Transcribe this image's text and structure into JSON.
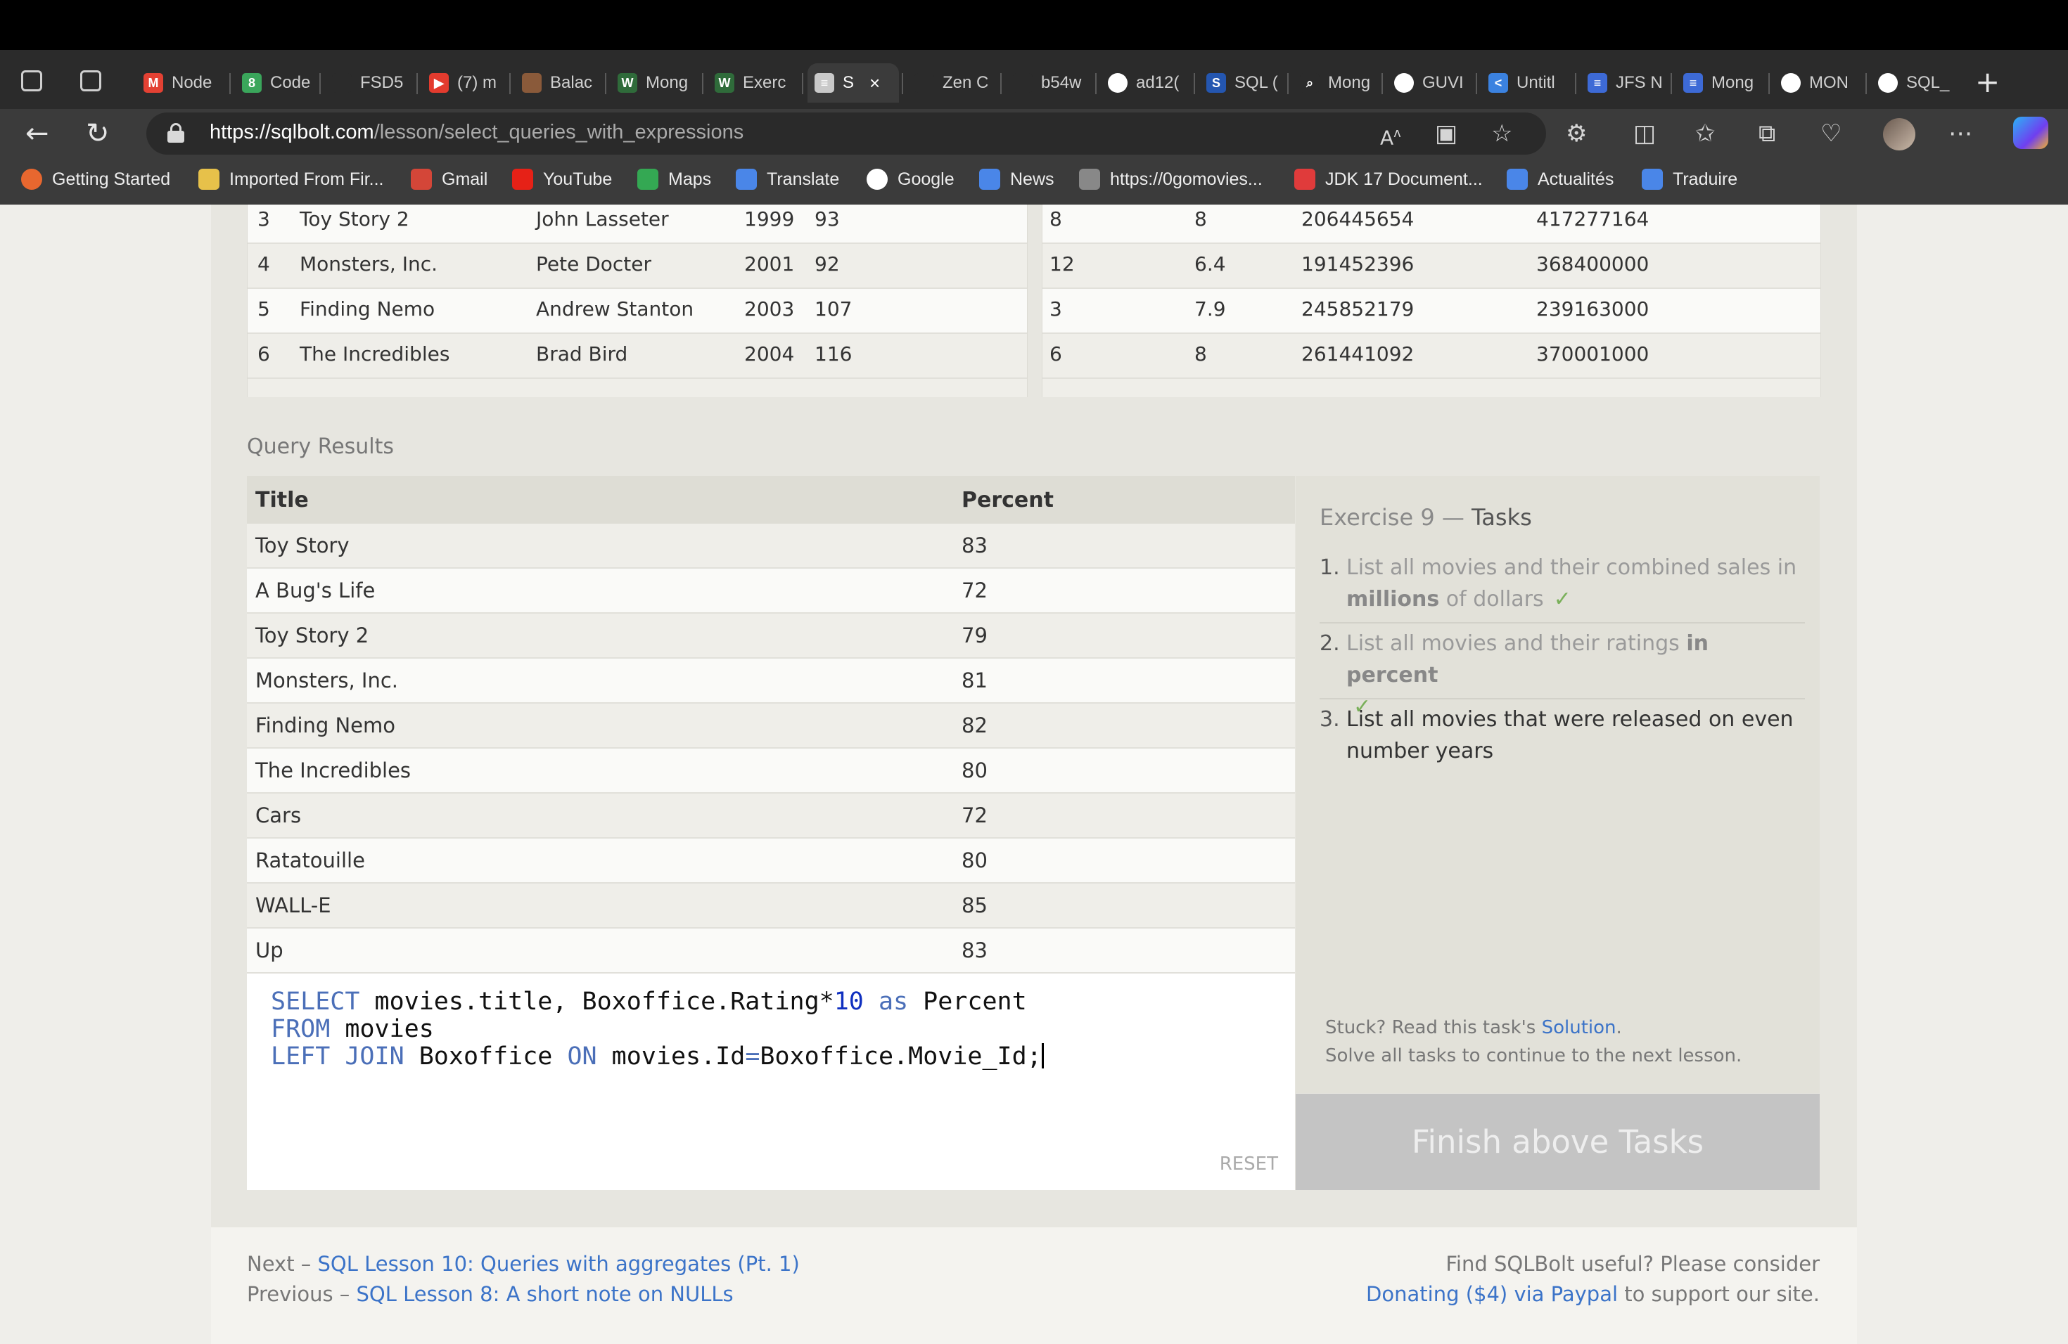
{
  "browser": {
    "tabs": [
      {
        "title": "Node",
        "fav_color": "#e34133",
        "fav_glyph": "M"
      },
      {
        "title": "Code",
        "fav_color": "#3aa65b",
        "fav_glyph": "8"
      },
      {
        "title": "FSD5",
        "fav_color": "#2b2b2b",
        "fav_glyph": ""
      },
      {
        "title": "(7) m",
        "fav_color": "#e33b2e",
        "fav_glyph": "▶"
      },
      {
        "title": "Balac",
        "fav_color": "#8a5a3a",
        "fav_glyph": ""
      },
      {
        "title": "Mong",
        "fav_color": "#2f6b3a",
        "fav_glyph": "W"
      },
      {
        "title": "Exerc",
        "fav_color": "#2f6b3a",
        "fav_glyph": "W"
      },
      {
        "title": "S",
        "fav_color": "#c9c9c9",
        "fav_glyph": "≡",
        "active": true
      },
      {
        "title": "Zen C",
        "fav_color": "#2b2b2b",
        "fav_glyph": ""
      },
      {
        "title": "b54w",
        "fav_color": "#2b2b2b",
        "fav_glyph": ""
      },
      {
        "title": "ad12(",
        "fav_color": "#ffffff",
        "fav_glyph": ""
      },
      {
        "title": "SQL (",
        "fav_color": "#2456b0",
        "fav_glyph": "S"
      },
      {
        "title": "Mong",
        "fav_color": "#2b2b2b",
        "fav_glyph": "⌕"
      },
      {
        "title": "GUVI",
        "fav_color": "#ffffff",
        "fav_glyph": ""
      },
      {
        "title": "Untitl",
        "fav_color": "#3b82e0",
        "fav_glyph": "<"
      },
      {
        "title": "JFS N",
        "fav_color": "#3d6ad6",
        "fav_glyph": "≡"
      },
      {
        "title": "Mong",
        "fav_color": "#3d6ad6",
        "fav_glyph": "≡"
      },
      {
        "title": "MON",
        "fav_color": "#ffffff",
        "fav_glyph": ""
      },
      {
        "title": "SQL_",
        "fav_color": "#ffffff",
        "fav_glyph": ""
      }
    ],
    "url_host": "https://sqlbolt.com",
    "url_path": "/lesson/select_queries_with_expressions",
    "bookmarks": [
      {
        "label": "Getting Started",
        "color": "#e8672f"
      },
      {
        "label": "Imported From Fir...",
        "color": "#e7c14a"
      },
      {
        "label": "Gmail",
        "color": "#d44638"
      },
      {
        "label": "YouTube",
        "color": "#e62117"
      },
      {
        "label": "Maps",
        "color": "#34a853"
      },
      {
        "label": "Translate",
        "color": "#4a86e8"
      },
      {
        "label": "Google",
        "color": "#ffffff"
      },
      {
        "label": "News",
        "color": "#4a86e8"
      },
      {
        "label": "https://0gomovies...",
        "color": "#888888"
      },
      {
        "label": "JDK 17 Document...",
        "color": "#e03b3b"
      },
      {
        "label": "Actualités",
        "color": "#4a86e8"
      },
      {
        "label": "Traduire",
        "color": "#4a86e8"
      }
    ]
  },
  "movies_table": {
    "rows": [
      [
        "3",
        "Toy Story 2",
        "John Lasseter",
        "1999",
        "93"
      ],
      [
        "4",
        "Monsters, Inc.",
        "Pete Docter",
        "2001",
        "92"
      ],
      [
        "5",
        "Finding Nemo",
        "Andrew Stanton",
        "2003",
        "107"
      ],
      [
        "6",
        "The Incredibles",
        "Brad Bird",
        "2004",
        "116"
      ]
    ]
  },
  "boxoffice_table": {
    "rows": [
      [
        "8",
        "8",
        "206445654",
        "417277164"
      ],
      [
        "12",
        "6.4",
        "191452396",
        "368400000"
      ],
      [
        "3",
        "7.9",
        "245852179",
        "239163000"
      ],
      [
        "6",
        "8",
        "261441092",
        "370001000"
      ]
    ]
  },
  "query_results": {
    "label": "Query Results",
    "columns": [
      "Title",
      "Percent"
    ],
    "rows": [
      [
        "Toy Story",
        "83"
      ],
      [
        "A Bug's Life",
        "72"
      ],
      [
        "Toy Story 2",
        "79"
      ],
      [
        "Monsters, Inc.",
        "81"
      ],
      [
        "Finding Nemo",
        "82"
      ],
      [
        "The Incredibles",
        "80"
      ],
      [
        "Cars",
        "72"
      ],
      [
        "Ratatouille",
        "80"
      ],
      [
        "WALL-E",
        "85"
      ],
      [
        "Up",
        "83"
      ]
    ]
  },
  "editor": {
    "line1_kw": "SELECT",
    "line1_a": " movies.title, Boxoffice.Rating*",
    "line1_num": "10",
    "line1_as": " as",
    "line1_b": " Percent",
    "line2_kw": "FROM",
    "line2_a": " movies",
    "line3_kw": "LEFT JOIN",
    "line3_a": " Boxoffice ",
    "line3_on": "ON",
    "line3_b": " movies.Id",
    "line3_eq": "=",
    "line3_c": "Boxoffice.Movie_Id;",
    "reset_label": "RESET"
  },
  "tasks": {
    "title_prefix": "Exercise 9 — ",
    "title_bold": "Tasks",
    "items": [
      {
        "num": "1.",
        "text_a": "List all movies and their combined sales in ",
        "bold": "millions",
        "text_b": " of dollars",
        "tick": "✓"
      },
      {
        "num": "2.",
        "text_a": "List all movies and their ratings ",
        "bold": "in percent",
        "text_b": "",
        "tick": "✓"
      },
      {
        "num": "3.",
        "text_a": "List all movies that were released on even number years",
        "bold": "",
        "text_b": "",
        "tick": ""
      }
    ],
    "stuck_prefix": "Stuck? Read this task's ",
    "solution_link": "Solution",
    "stuck_suffix": ".",
    "solve_all": "Solve all tasks to continue to the next lesson.",
    "finish_button": "Finish above Tasks"
  },
  "footer": {
    "next_prefix": "Next – ",
    "next_link": "SQL Lesson 10: Queries with aggregates (Pt. 1)",
    "prev_prefix": "Previous – ",
    "prev_link": "SQL Lesson 8: A short note on NULLs",
    "consider": "Find SQLBolt useful? Please consider",
    "donate_link": "Donating ($4) via Paypal",
    "donate_suffix": " to support our site."
  }
}
